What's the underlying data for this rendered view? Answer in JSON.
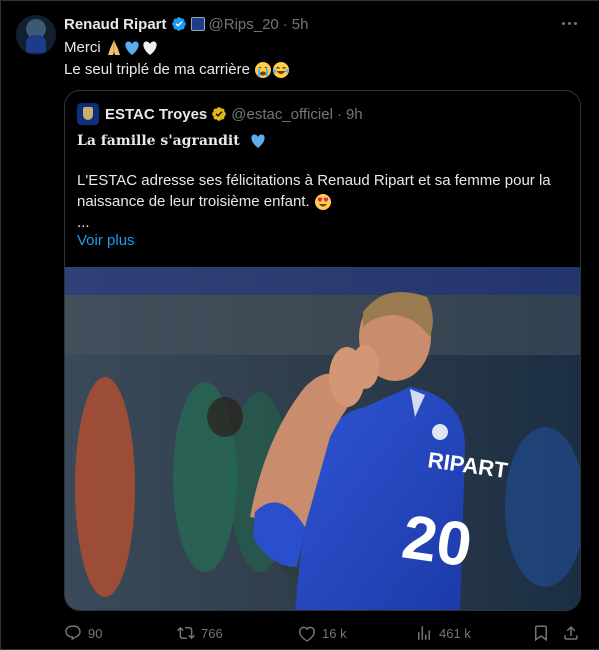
{
  "tweet": {
    "author_name": "Renaud Ripart",
    "handle": "@Rips_20",
    "separator": "·",
    "time": "5h",
    "line1": "Merci",
    "line2": "Le seul triplé de ma carrière",
    "line1_emojis": [
      "folded-hands",
      "blue-heart",
      "white-heart"
    ],
    "line2_emojis": [
      "crying-face",
      "tears-of-joy-face"
    ]
  },
  "quote": {
    "author_name": "ESTAC Troyes",
    "handle": "@estac_officiel",
    "separator": "·",
    "time": "9h",
    "title": "La famille s'agrandit",
    "body": "L'ESTAC adresse ses félicitations à Renaud Ripart et sa femme pour la naissance de leur troisième enfant.",
    "ellipsis": "...",
    "see_more": "Voir plus",
    "jersey_name": "RIPART",
    "jersey_number": "20"
  },
  "actions": {
    "replies": "90",
    "reposts": "766",
    "likes": "16 k",
    "views": "461 k"
  },
  "colors": {
    "background": "#000000",
    "border": "#2f3336",
    "muted": "#71767b",
    "link": "#1d9bf0",
    "verified_blue": "#1d9bf0",
    "verified_gold": "#e2b719"
  }
}
